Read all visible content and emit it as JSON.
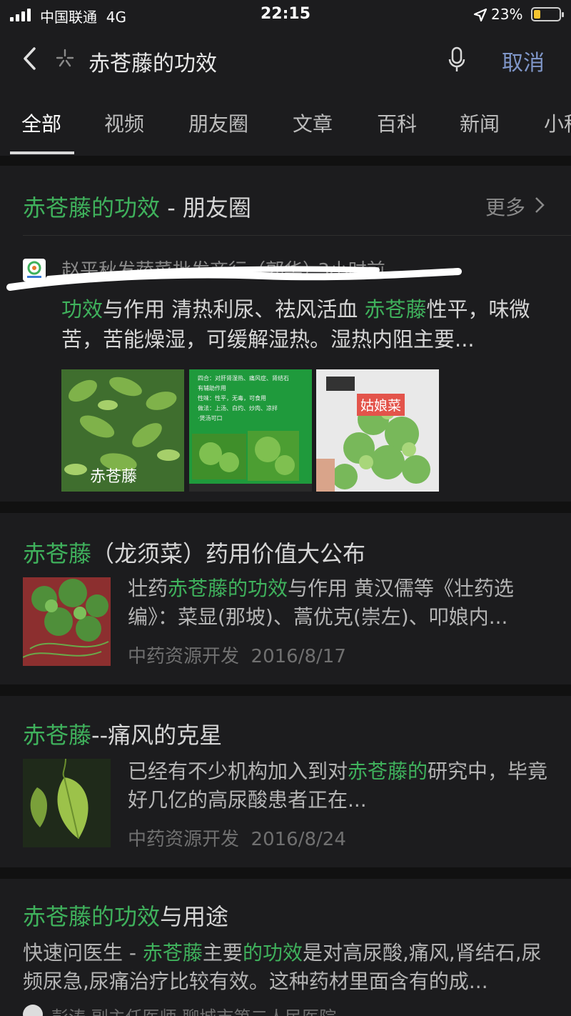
{
  "status_bar": {
    "carrier": "中国联通",
    "network": "4G",
    "time": "22:15",
    "battery": "23%"
  },
  "search": {
    "query": "赤苍藤的功效",
    "cancel_label": "取消"
  },
  "tabs": [
    "全部",
    "视频",
    "朋友圈",
    "文章",
    "百科",
    "新闻",
    "小程序"
  ],
  "moments_section": {
    "title_hl": "赤苍藤的功效",
    "title_rest": " - 朋友圈",
    "more_label": "更多",
    "author": "赵平秋发蔬菜批发商行（郭华）·3小时前",
    "text_hl1": "功效",
    "text_1": "与作用 清热利尿、祛风活血 ",
    "text_hl2": "赤苍藤",
    "text_2": "性平，味微苦，苦能燥湿，可缓解湿热。湿热内阻主要...",
    "images": [
      {
        "label": "赤苍藤"
      },
      {
        "lines": [
          "四合：对肝肾湿热、痛风症、肾结石",
          "有辅助作用",
          "性味：性平，无毒，可食用",
          "做法：上汤、白灼、炒肉、凉拌",
          "·煲汤可口"
        ]
      },
      {
        "tag": "姑娘菜"
      }
    ]
  },
  "articles": [
    {
      "title_hl": "赤苍藤",
      "title_rest": "（龙须菜）药用价值大公布",
      "snippet_1": "壮药",
      "snippet_hl": "赤苍藤的功效",
      "snippet_2": "与作用 黄汉儒等《壮药选编》：菜显(那坡)、蒿优克(崇左)、叩娘内...",
      "source": "中药资源开发",
      "date": "2016/8/17"
    },
    {
      "title_hl": "赤苍藤",
      "title_rest": "--痛风的克星",
      "snippet_1": "已经有不少机构加入到对",
      "snippet_hl": "赤苍藤的",
      "snippet_2": "研究中，毕竟好几亿的高尿酸患者正在...",
      "source": "中药资源开发",
      "date": "2016/8/24"
    }
  ],
  "qa": {
    "title_hl": "赤苍藤的功效",
    "title_rest": "与用途",
    "snippet_1": "快速问医生 - ",
    "snippet_hl1": "赤苍藤",
    "snippet_2": "主要",
    "snippet_hl2": "的功效",
    "snippet_3": "是对高尿酸,痛风,肾结石,尿频尿急,尿痛治疗比较有效。这种药材里面含有的成...",
    "doctor": "彭涛 副主任医师 聊城市第二人民医院"
  },
  "colors": {
    "highlight": "#3fb15c",
    "cancel": "#7f96c8",
    "background": "#111111",
    "card": "#1c1c1e"
  }
}
